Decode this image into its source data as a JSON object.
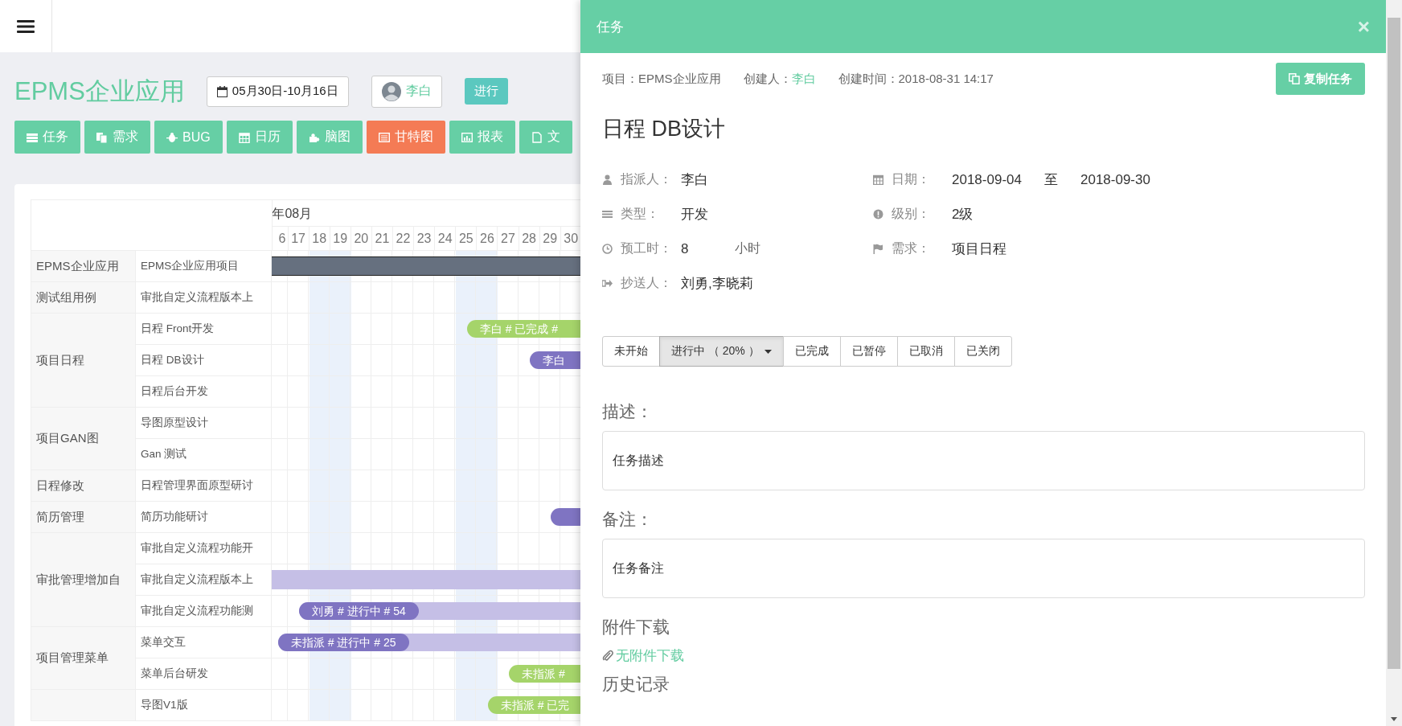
{
  "page": {
    "title": "EPMS企业应用",
    "date_range": "05月30日-10月16日",
    "user": "李白",
    "status_button": "进行"
  },
  "tabs": [
    {
      "label": "任务",
      "selected": false
    },
    {
      "label": "需求",
      "selected": false
    },
    {
      "label": "BUG",
      "selected": false
    },
    {
      "label": "日历",
      "selected": false
    },
    {
      "label": "脑图",
      "selected": false
    },
    {
      "label": "甘特图",
      "selected": true
    },
    {
      "label": "报表",
      "selected": false
    },
    {
      "label": "文",
      "selected": false
    }
  ],
  "gantt": {
    "month": "年08月",
    "days": [
      {
        "label": "6",
        "weekend": false
      },
      {
        "label": "17",
        "weekend": false
      },
      {
        "label": "18",
        "weekend": true
      },
      {
        "label": "19",
        "weekend": true
      },
      {
        "label": "20",
        "weekend": false
      },
      {
        "label": "21",
        "weekend": false
      },
      {
        "label": "22",
        "weekend": false
      },
      {
        "label": "23",
        "weekend": false
      },
      {
        "label": "24",
        "weekend": false
      },
      {
        "label": "25",
        "weekend": true
      },
      {
        "label": "26",
        "weekend": true
      },
      {
        "label": "27",
        "weekend": false
      },
      {
        "label": "28",
        "weekend": false
      },
      {
        "label": "29",
        "weekend": false
      },
      {
        "label": "30",
        "weekend": false
      }
    ],
    "groups": [
      {
        "name": "EPMS企业应用",
        "tasks": [
          {
            "name": "EPMS企业应用项目",
            "bar": {
              "kind": "bar",
              "color": "#66707f"
            }
          }
        ]
      },
      {
        "name": "测试组用例",
        "tasks": [
          {
            "name": "审批自定义流程版本上"
          }
        ]
      },
      {
        "name": "项目日程",
        "tasks": [
          {
            "name": "日程 Front开发",
            "bar": {
              "kind": "pill",
              "color": "#a5d46a",
              "label": "李白 # 已完成 #"
            }
          },
          {
            "name": "日程 DB设计",
            "bar": {
              "kind": "pill",
              "color": "#7f74c2",
              "label": "李白"
            }
          },
          {
            "name": "日程后台开发"
          }
        ]
      },
      {
        "name": "项目GAN图",
        "tasks": [
          {
            "name": "导图原型设计"
          },
          {
            "name": "Gan 测试"
          }
        ]
      },
      {
        "name": "日程修改",
        "tasks": [
          {
            "name": "日程管理界面原型研讨"
          }
        ]
      },
      {
        "name": "简历管理",
        "tasks": [
          {
            "name": "简历功能研讨",
            "bar": {
              "kind": "edge",
              "color": "#7f74c2"
            }
          }
        ]
      },
      {
        "name": "审批管理增加自",
        "tasks": [
          {
            "name": "审批自定义流程功能开"
          },
          {
            "name": "审批自定义流程版本上",
            "bar": {
              "kind": "bar",
              "color": "#c5bfe6"
            }
          },
          {
            "name": "审批自定义流程功能测",
            "bar": {
              "kind": "progress",
              "color": "#7f74c2",
              "label": "刘勇 # 进行中 # 54"
            }
          }
        ]
      },
      {
        "name": "项目管理菜单",
        "tasks": [
          {
            "name": "菜单交互",
            "bar": {
              "kind": "progress",
              "color": "#7f74c2",
              "label": "未指派 # 进行中 # 25"
            }
          },
          {
            "name": "菜单后台研发",
            "bar": {
              "kind": "pill",
              "color": "#a5d46a",
              "label": "未指派 #"
            }
          }
        ]
      },
      {
        "tasks": [
          {
            "name": "导图V1版",
            "bar": {
              "kind": "pill",
              "color": "#a5d46a",
              "label": "未指派 # 已完"
            }
          }
        ]
      }
    ]
  },
  "panel": {
    "title": "任务",
    "close": "×",
    "meta": {
      "project": "项目：EPMS企业应用",
      "creator_label": "创建人：",
      "creator": "李白",
      "created": "创建时间：2018-08-31 14:17"
    },
    "copy_button": "复制任务",
    "task_title": "日程 DB设计",
    "fields_left": [
      {
        "label": "指派人：",
        "values": [
          "李白"
        ]
      },
      {
        "label": "类型：",
        "values": [
          "开发"
        ]
      },
      {
        "label": "预工时：",
        "values": [
          "8",
          "小时"
        ]
      },
      {
        "label": "抄送人：",
        "values": [
          "刘勇,李晓莉"
        ]
      }
    ],
    "fields_right": [
      {
        "label": "日期：",
        "values": [
          "2018-09-04",
          "至",
          "2018-09-30"
        ]
      },
      {
        "label": "级别：",
        "values": [
          "2级"
        ]
      },
      {
        "label": "需求：",
        "values": [
          "项目日程"
        ]
      }
    ],
    "statuses": [
      {
        "label": "未开始",
        "selected": false
      },
      {
        "label": "进行中 （ 20% ）",
        "selected": true
      },
      {
        "label": "已完成",
        "selected": false
      },
      {
        "label": "已暂停",
        "selected": false
      },
      {
        "label": "已取消",
        "selected": false
      },
      {
        "label": "已关闭",
        "selected": false
      }
    ],
    "description_heading": "描述：",
    "description": "任务描述",
    "note_heading": "备注：",
    "note": "任务备注",
    "attachments_heading": "附件下载",
    "attachment_link": "无附件下载",
    "history_heading": "历史记录"
  }
}
